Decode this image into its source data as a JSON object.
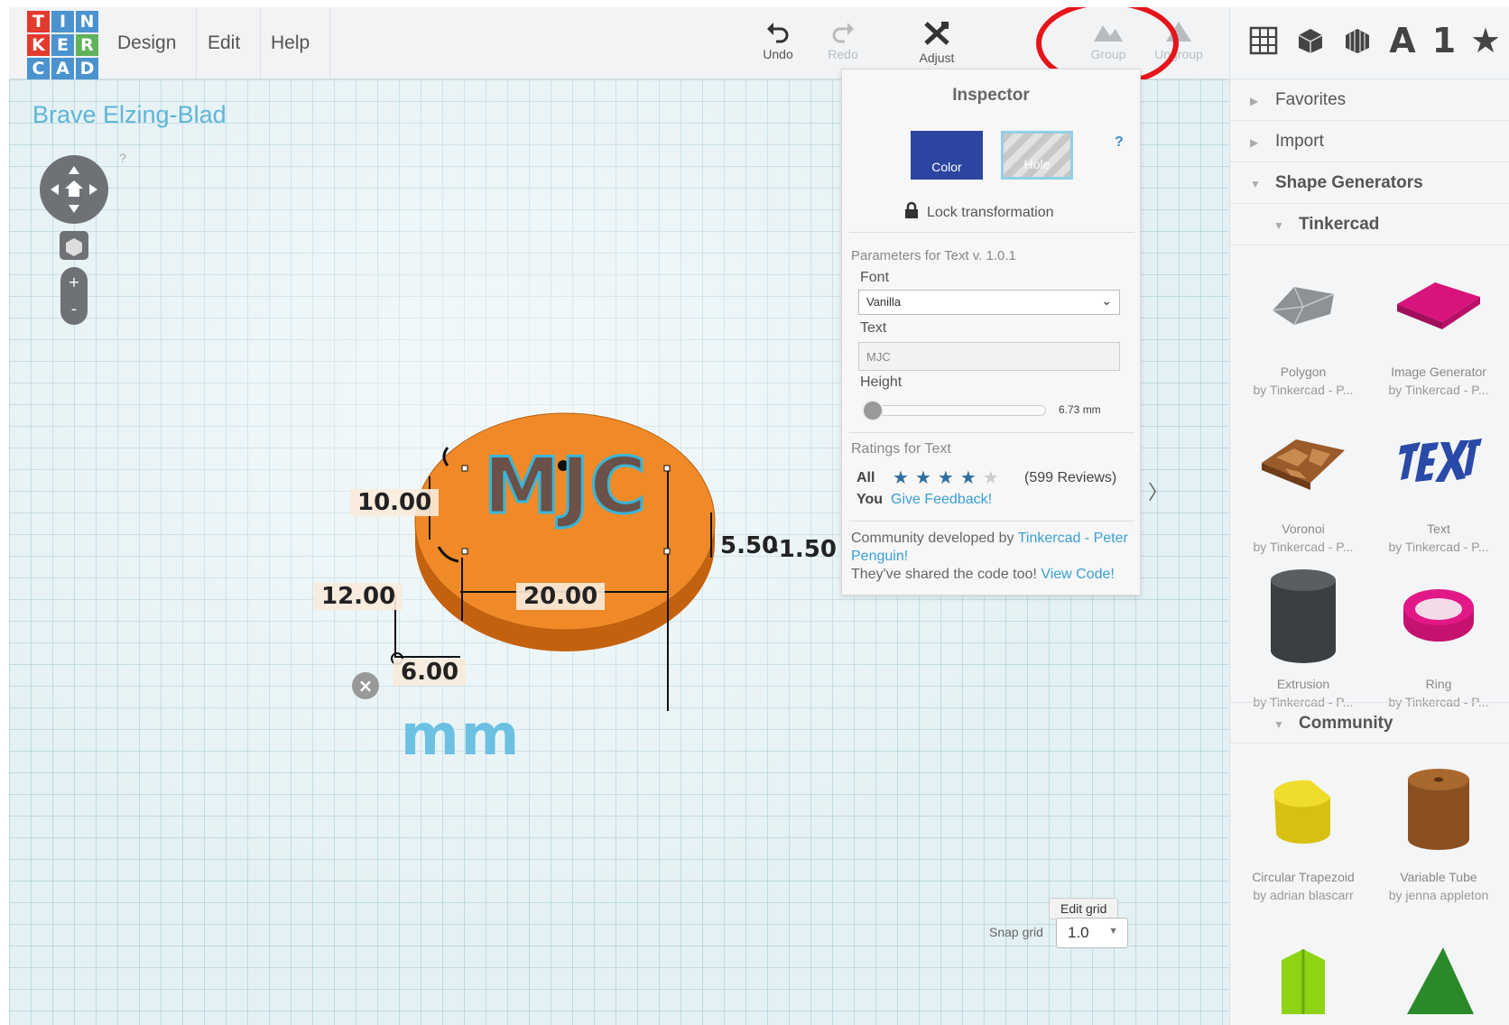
{
  "app": {
    "logo_letters": [
      "T",
      "I",
      "N",
      "K",
      "E",
      "R",
      "C",
      "A",
      "D"
    ],
    "logo_colors": [
      "#e33a2e",
      "#4a93cf",
      "#4a93cf",
      "#e33a2e",
      "#4a93cf",
      "#5fb35a",
      "#4a93cf",
      "#4a93cf",
      "#4a93cf"
    ],
    "menu": [
      "Design",
      "Edit",
      "Help"
    ]
  },
  "toolbar": {
    "undo_label": "Undo",
    "redo_label": "Redo",
    "adjust_label": "Adjust",
    "group_label": "Group",
    "ungroup_label": "Ungroup"
  },
  "right_tools": {
    "text_tool": "A",
    "number_tool": "1",
    "favorite_tool": "★"
  },
  "design_title": "Brave Elzing-Blad",
  "viewport": {
    "nav_help": "?",
    "dimensions": {
      "width": "20.00",
      "depth": "10.00",
      "elevation": "12.00",
      "offset": "6.00",
      "height_a": "5.50",
      "height_b": "-1.50"
    },
    "object_text": "MJC",
    "unit_label": "mm",
    "close_symbol": "×",
    "edit_grid_label": "Edit grid",
    "snap_label": "Snap grid",
    "snap_value": "1.0"
  },
  "inspector": {
    "title": "Inspector",
    "color_label": "Color",
    "hole_label": "Hole",
    "help": "?",
    "lock_label": "Lock transformation",
    "params_title": "Parameters for Text v. 1.0.1",
    "font_label": "Font",
    "font_value": "Vanilla",
    "text_label": "Text",
    "text_value": "MJC",
    "height_label": "Height",
    "height_value": "6.73 mm",
    "height_fraction": 0.02,
    "ratings_title": "Ratings for Text",
    "ratings_all_label": "All",
    "rating_stars": 4,
    "rating_count": "(599 Reviews)",
    "you_label": "You",
    "feedback_link": "Give Feedback!",
    "community_text": "Community developed by",
    "author_link": "Tinkercad - Peter Penguin!",
    "code_text": "They've shared the code too!",
    "code_link": "View Code!"
  },
  "shapes_panel": {
    "favorites": "Favorites",
    "import": "Import",
    "shape_generators": "Shape Generators",
    "tinkercad": "Tinkercad",
    "community": "Community",
    "items": [
      {
        "name": "Polygon",
        "by": "by Tinkercad - P..."
      },
      {
        "name": "Image Generator",
        "by": "by Tinkercad - P..."
      },
      {
        "name": "Voronoi",
        "by": "by Tinkercad - P..."
      },
      {
        "name": "Text",
        "by": "by Tinkercad - P..."
      },
      {
        "name": "Extrusion",
        "by": "by Tinkercad - P..."
      },
      {
        "name": "Ring",
        "by": "by Tinkercad - P..."
      },
      {
        "name": "Circular Trapezoid",
        "by": "by adrian blascarr"
      },
      {
        "name": "Variable Tube",
        "by": "by jenna appleton"
      }
    ]
  }
}
